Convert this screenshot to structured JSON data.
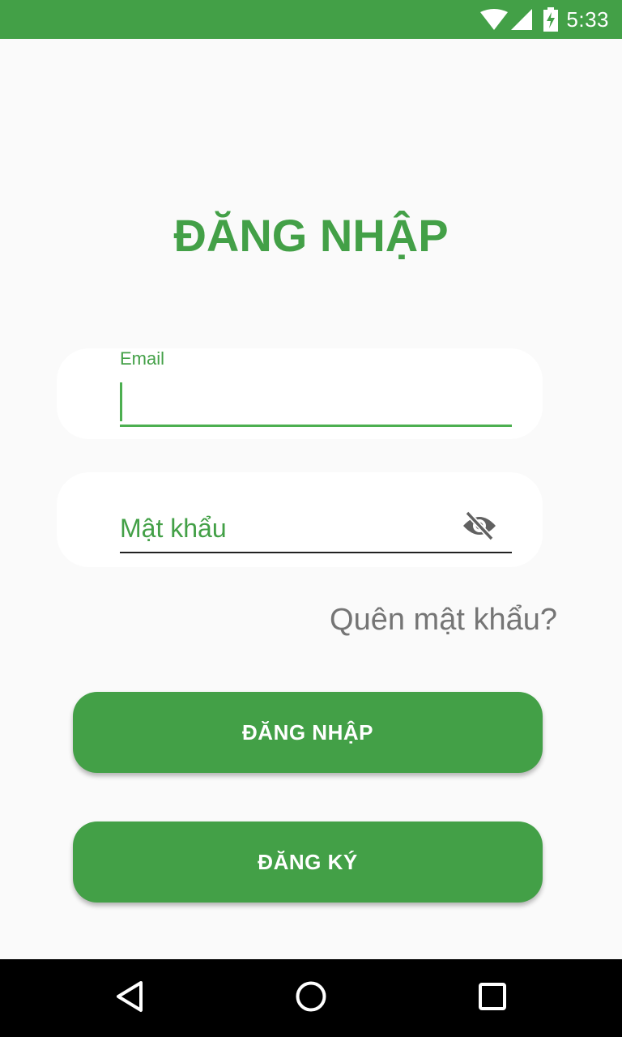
{
  "status_bar": {
    "time": "5:33",
    "icons": [
      "wifi-icon",
      "cellular-signal-icon",
      "battery-charging-icon"
    ]
  },
  "login": {
    "title": "ĐĂNG NHẬP",
    "email": {
      "label": "Email",
      "value": ""
    },
    "password": {
      "placeholder": "Mật khẩu",
      "value": "",
      "toggle_icon": "visibility-off-icon"
    },
    "forgot_password": "Quên mật khẩu?",
    "login_button": "ĐĂNG NHẬP",
    "register_button": "ĐĂNG KÝ"
  },
  "nav_bar": {
    "icons": [
      "back-icon",
      "home-icon",
      "recents-icon"
    ]
  },
  "colors": {
    "primary": "#43a047",
    "accent": "#4caf50",
    "background": "#fafafa",
    "card": "#ffffff",
    "muted_text": "#757575",
    "nav_bar": "#000000"
  }
}
